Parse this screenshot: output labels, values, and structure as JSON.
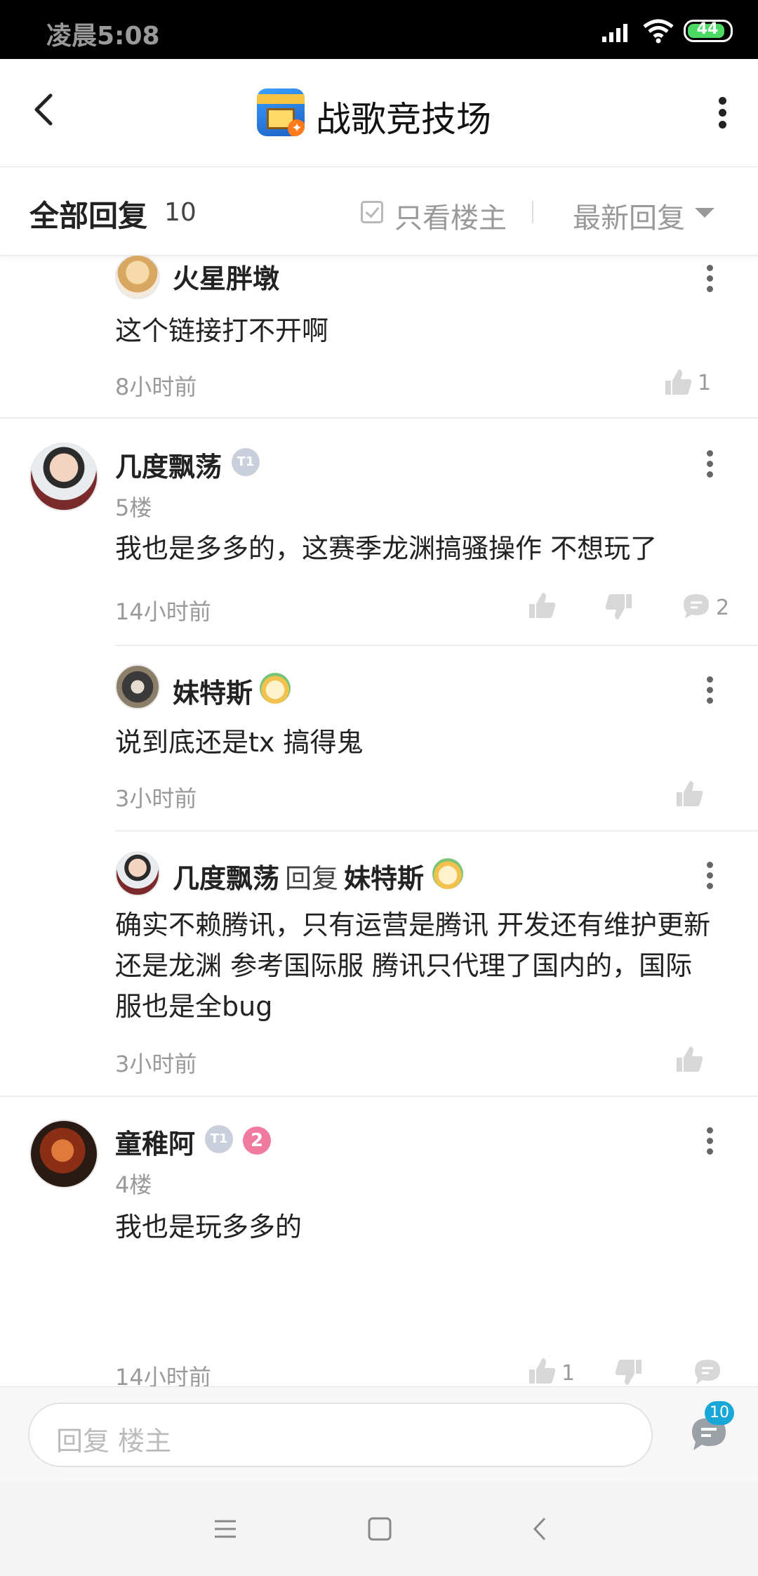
{
  "status_bar": {
    "time": "凌晨5:08",
    "battery": "44"
  },
  "app": {
    "title": "战歌竞技场",
    "icon": "game-app-icon"
  },
  "header": {
    "all_replies_label": "全部回复",
    "reply_count": "10",
    "only_op_label": "只看楼主",
    "sort_label": "最新回复"
  },
  "comments": {
    "c1": {
      "name": "火星胖墩",
      "text": "这个链接打不开啊",
      "time": "8小时前",
      "likes": "1"
    },
    "c2": {
      "name": "几度飘荡",
      "floor": "5楼",
      "text": "我也是多多的，这赛季龙渊搞骚操作 不想玩了",
      "time": "14小时前",
      "replies": "2",
      "level_badge": "T1"
    },
    "c2r1": {
      "name": "妹特斯",
      "text": "说到底还是tx 搞得鬼",
      "time": "3小时前"
    },
    "c2r2": {
      "name": "几度飘荡",
      "reply_word": "回复",
      "reply_to": "妹特斯",
      "text_lines": [
        "确实不赖腾讯，只有运营是腾讯 开发还有维护更新",
        "还是龙渊 参考国际服 腾讯只代理了国内的，国际",
        "服也是全bug"
      ],
      "time": "3小时前"
    },
    "c3": {
      "name": "童稚阿",
      "floor": "4楼",
      "text": "我也是玩多多的",
      "time": "14小时前",
      "likes": "1",
      "level_badge": "T1",
      "rank_badge": "2"
    }
  },
  "input": {
    "placeholder": "回复  楼主",
    "comment_badge": "10"
  },
  "colors": {
    "accent": "#19a7d8",
    "text": "#222222",
    "muted": "#999999",
    "rank_badge": "#f07aa0"
  }
}
